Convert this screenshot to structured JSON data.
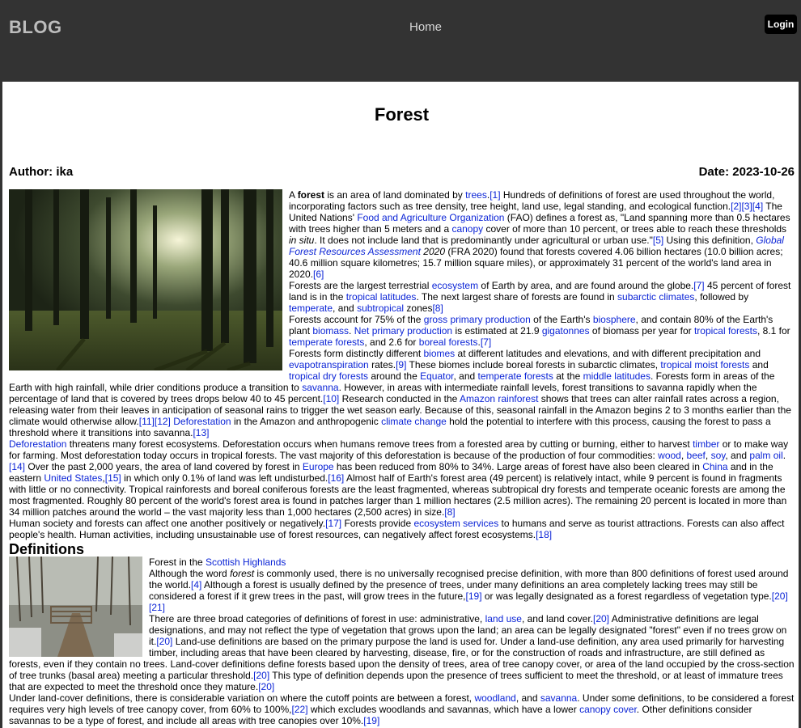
{
  "header": {
    "brand": "BLOG",
    "nav_home": "Home",
    "login": "Login"
  },
  "article": {
    "title": "Forest",
    "author": "Author: ika",
    "date": "Date: 2023-10-26"
  },
  "intro_image": "Forest with sunlight streaming through tree trunks",
  "definitions_heading": "Definitions",
  "definitions_image": "Forest in the Scottish Highlands — path and gate among bare trees",
  "colors": {
    "header_bg": "#333333",
    "link": "#0b24d6",
    "login_bg": "#000000"
  }
}
